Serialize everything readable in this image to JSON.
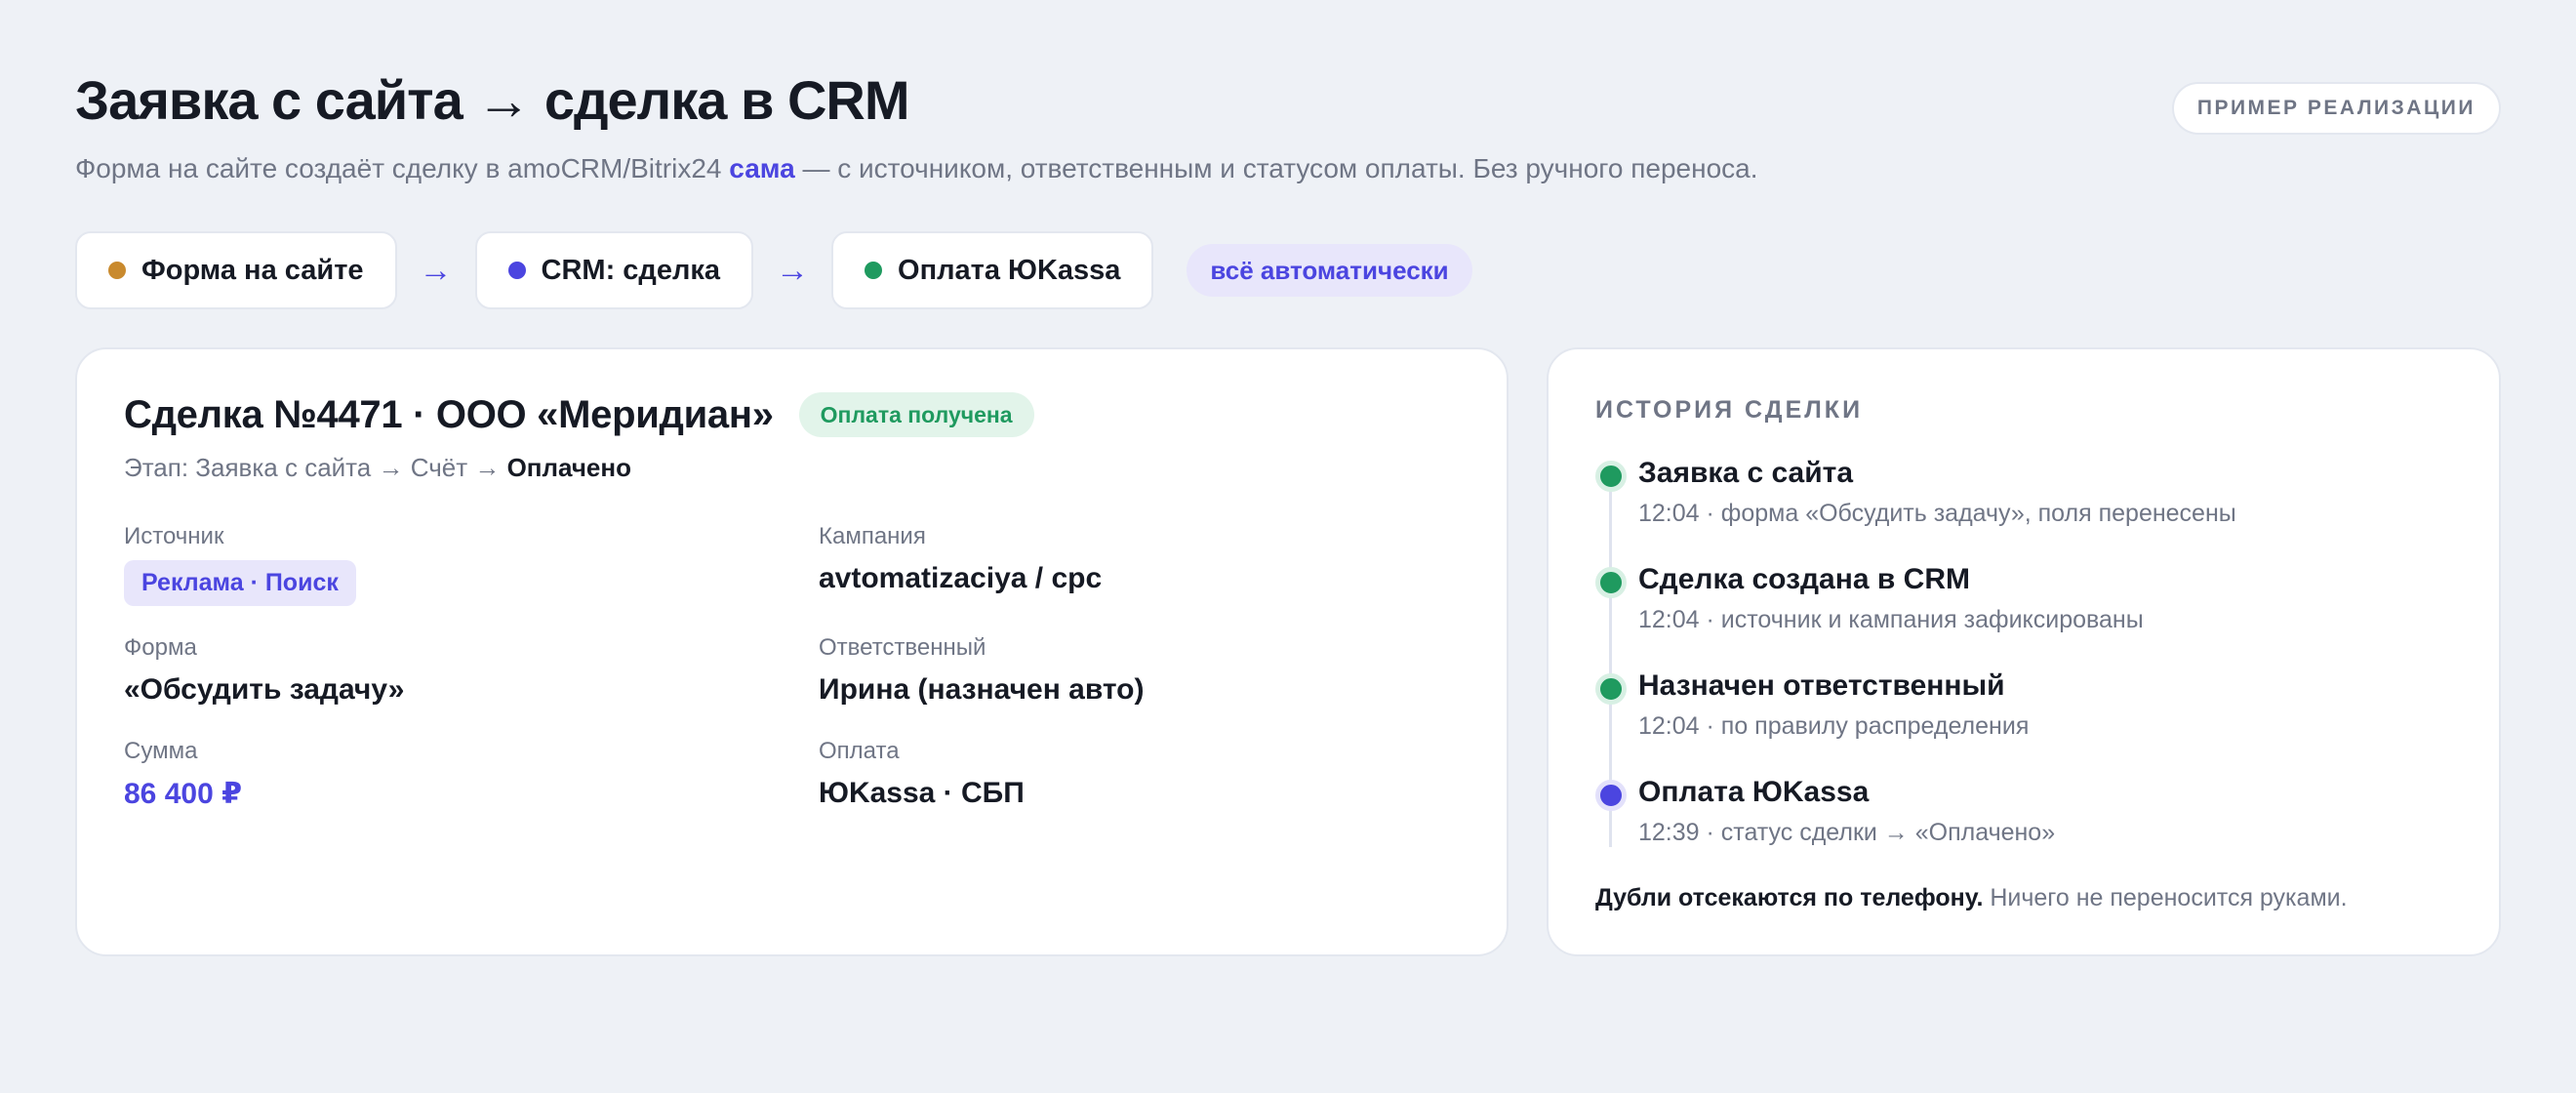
{
  "header": {
    "title": "Заявка с сайта → сделка в CRM",
    "subtitle_before": "Форма на сайте создаёт сделку в amoCRM/Bitrix24 ",
    "subtitle_accent": "сама",
    "subtitle_after": " — с источником, ответственным и статусом оплаты. Без ручного переноса.",
    "badge": "ПРИМЕР РЕАЛИЗАЦИИ"
  },
  "flow": {
    "steps": [
      {
        "label": "Форма на сайте",
        "color": "#c98a2e"
      },
      {
        "label": "CRM: сделка",
        "color": "#4b45e0"
      },
      {
        "label": "Оплата ЮKassa",
        "color": "#1f9a5f"
      }
    ],
    "arrow": "→",
    "auto_label": "всё автоматически"
  },
  "deal": {
    "title": "Сделка №4471 · ООО «Меридиан»",
    "status_badge": "Оплата получена",
    "stage_prefix": "Этап: Заявка с сайта → Счёт → ",
    "stage_current": "Оплачено",
    "fields": {
      "source_label": "Источник",
      "source_value": "Реклама · Поиск",
      "campaign_label": "Кампания",
      "campaign_value": "avtomatizaciya / cpc",
      "form_label": "Форма",
      "form_value": "«Обсудить задачу»",
      "owner_label": "Ответственный",
      "owner_value": "Ирина (назначен авто)",
      "sum_label": "Сумма",
      "sum_value": "86 400 ₽",
      "payment_label": "Оплата",
      "payment_value": "ЮKassa · СБП"
    }
  },
  "history": {
    "heading": "ИСТОРИЯ СДЕЛКИ",
    "events": [
      {
        "title": "Заявка с сайта",
        "desc": "12:04 · форма «Обсудить задачу», поля перенесены",
        "color": "#1f9a5f"
      },
      {
        "title": "Сделка создана в CRM",
        "desc": "12:04 · источник и кампания зафиксированы",
        "color": "#1f9a5f"
      },
      {
        "title": "Назначен ответственный",
        "desc": "12:04 · по правилу распределения",
        "color": "#1f9a5f"
      },
      {
        "title": "Оплата ЮKassa",
        "desc": "12:39 · статус сделки → «Оплачено»",
        "color": "#4b45e0"
      }
    ],
    "footer_bold": "Дубли отсекаются по телефону.",
    "footer_rest": " Ничего не переносится руками."
  }
}
